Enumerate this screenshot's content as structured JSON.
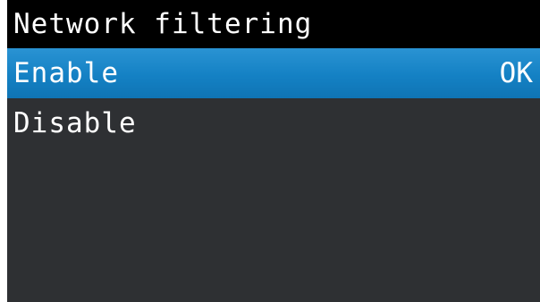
{
  "screen": {
    "title": "Network filtering",
    "colors": {
      "background": "#2e3033",
      "title_bar": "#000000",
      "selection": "#1683c6",
      "text": "#ffffff"
    }
  },
  "menu": {
    "items": [
      {
        "label": "Enable",
        "status": "OK",
        "selected": true
      },
      {
        "label": "Disable",
        "status": "",
        "selected": false
      }
    ]
  }
}
